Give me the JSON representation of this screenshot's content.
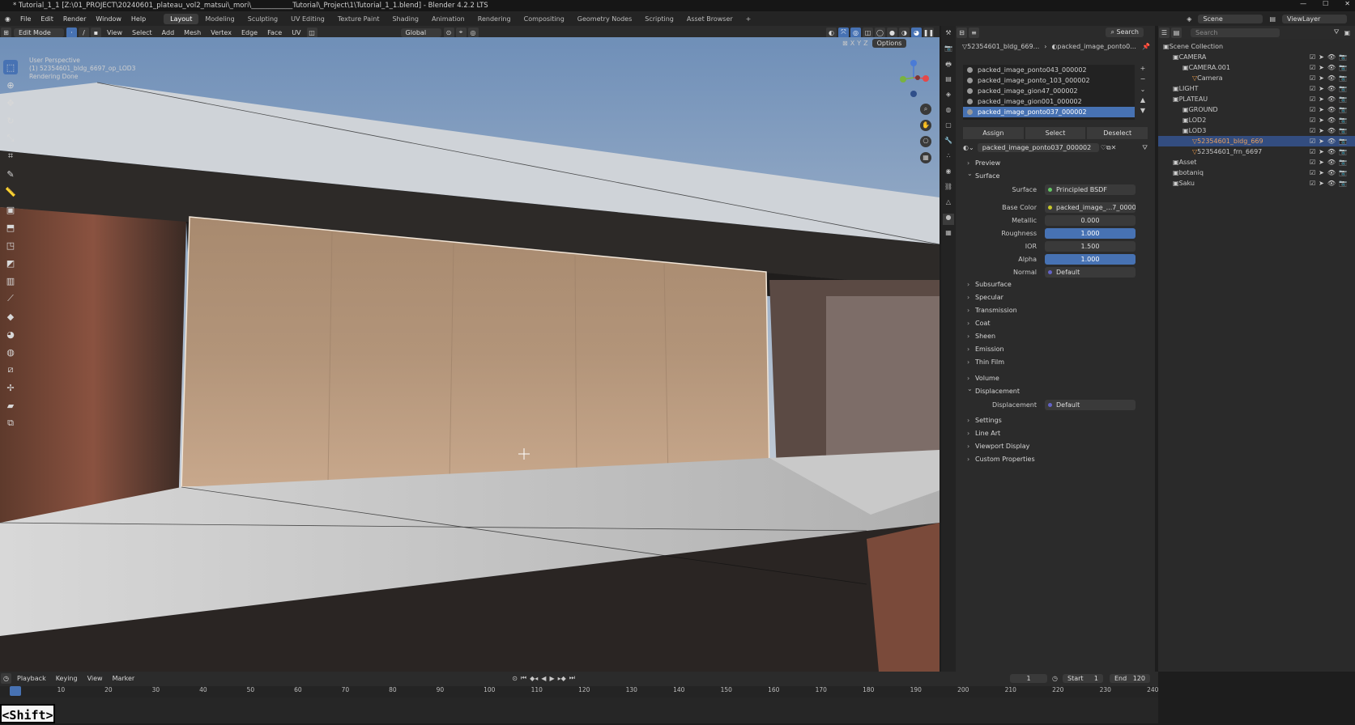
{
  "window": {
    "title": "* Tutorial_1_1 [Z:\\01_PROJECT\\20240601_plateau_vol2_matsui\\_mori\\____________Tutorial\\_Project\\1\\Tutorial_1_1.blend] - Blender 4.2.2 LTS"
  },
  "menus": [
    "File",
    "Edit",
    "Render",
    "Window",
    "Help"
  ],
  "workspaces": [
    "Layout",
    "Modeling",
    "Sculpting",
    "UV Editing",
    "Texture Paint",
    "Shading",
    "Animation",
    "Rendering",
    "Compositing",
    "Geometry Nodes",
    "Scripting",
    "Asset Browser",
    "+"
  ],
  "top_right": {
    "scene": "Scene",
    "view_layer": "ViewLayer"
  },
  "viewport_header": {
    "mode": "Edit Mode",
    "menus": [
      "View",
      "Select",
      "Add",
      "Mesh",
      "Vertex",
      "Edge",
      "Face",
      "UV"
    ],
    "orientation": "Global",
    "axes": [
      "X",
      "Y",
      "Z"
    ],
    "options": "Options"
  },
  "viewport_info": {
    "line1": "User Perspective",
    "line2": "(1) 52354601_bldg_6697_op_LOD3",
    "line3": "Rendering Done"
  },
  "gizmo": {
    "x_color": "#e54848",
    "y_color": "#79b340",
    "z_color": "#4a7bd6"
  },
  "properties": {
    "breadcrumb_object": "52354601_bldg_669...",
    "breadcrumb_material": "packed_image_ponto0...",
    "slots": [
      "packed_image_ponto043_000002",
      "packed_image_ponto_103_000002",
      "packed_image_gion47_000002",
      "packed_image_gion001_000002",
      "packed_image_ponto037_000002"
    ],
    "selected_slot": 4,
    "assign": "Assign",
    "select": "Select",
    "deselect": "Deselect",
    "material_name": "packed_image_ponto037_000002",
    "preview": "Preview",
    "surface_section": "Surface",
    "surface_label": "Surface",
    "surface_value": "Principled BSDF",
    "base_color_label": "Base Color",
    "base_color_value": "packed_image_...7_000002.png",
    "metallic_label": "Metallic",
    "metallic_value": "0.000",
    "roughness_label": "Roughness",
    "roughness_value": "1.000",
    "ior_label": "IOR",
    "ior_value": "1.500",
    "alpha_label": "Alpha",
    "alpha_value": "1.000",
    "normal_label": "Normal",
    "normal_value": "Default",
    "subsections": [
      "Subsurface",
      "Specular",
      "Transmission",
      "Coat",
      "Sheen",
      "Emission",
      "Thin Film"
    ],
    "volume": "Volume",
    "displacement_section": "Displacement",
    "displacement_label": "Displacement",
    "displacement_value": "Default",
    "more_sections": [
      "Settings",
      "Line Art",
      "Viewport Display",
      "Custom Properties"
    ]
  },
  "outliner": {
    "search_placeholder": "Search",
    "items": [
      {
        "label": "Scene Collection",
        "indent": 0
      },
      {
        "label": "CAMERA",
        "indent": 1
      },
      {
        "label": "CAMERA.001",
        "indent": 2
      },
      {
        "label": "Camera",
        "indent": 3
      },
      {
        "label": "LIGHT",
        "indent": 1
      },
      {
        "label": "PLATEAU",
        "indent": 1
      },
      {
        "label": "GROUND",
        "indent": 2
      },
      {
        "label": "LOD2",
        "indent": 2
      },
      {
        "label": "LOD3",
        "indent": 2
      },
      {
        "label": "52354601_bldg_669",
        "indent": 3
      },
      {
        "label": "52354601_frn_6697",
        "indent": 3
      },
      {
        "label": "Asset",
        "indent": 1
      },
      {
        "label": "botaniq",
        "indent": 1
      },
      {
        "label": "Saku",
        "indent": 1
      }
    ],
    "selected_index": 9
  },
  "timeline": {
    "menus": [
      "Playback",
      "Keying",
      "View",
      "Marker"
    ],
    "current_frame": "1",
    "start_label": "Start",
    "start_value": "1",
    "end_label": "End",
    "end_value": "120",
    "ticks": [
      "1",
      "10",
      "20",
      "30",
      "40",
      "50",
      "60",
      "70",
      "80",
      "90",
      "100",
      "110",
      "120",
      "130",
      "140",
      "150",
      "160",
      "170",
      "180",
      "190",
      "200",
      "210",
      "220",
      "230",
      "240"
    ]
  },
  "key_overlay": "<Shift>",
  "colors": {
    "accent": "#4772b3",
    "header": "#2b2b2b",
    "panel": "#2b2b2b"
  }
}
